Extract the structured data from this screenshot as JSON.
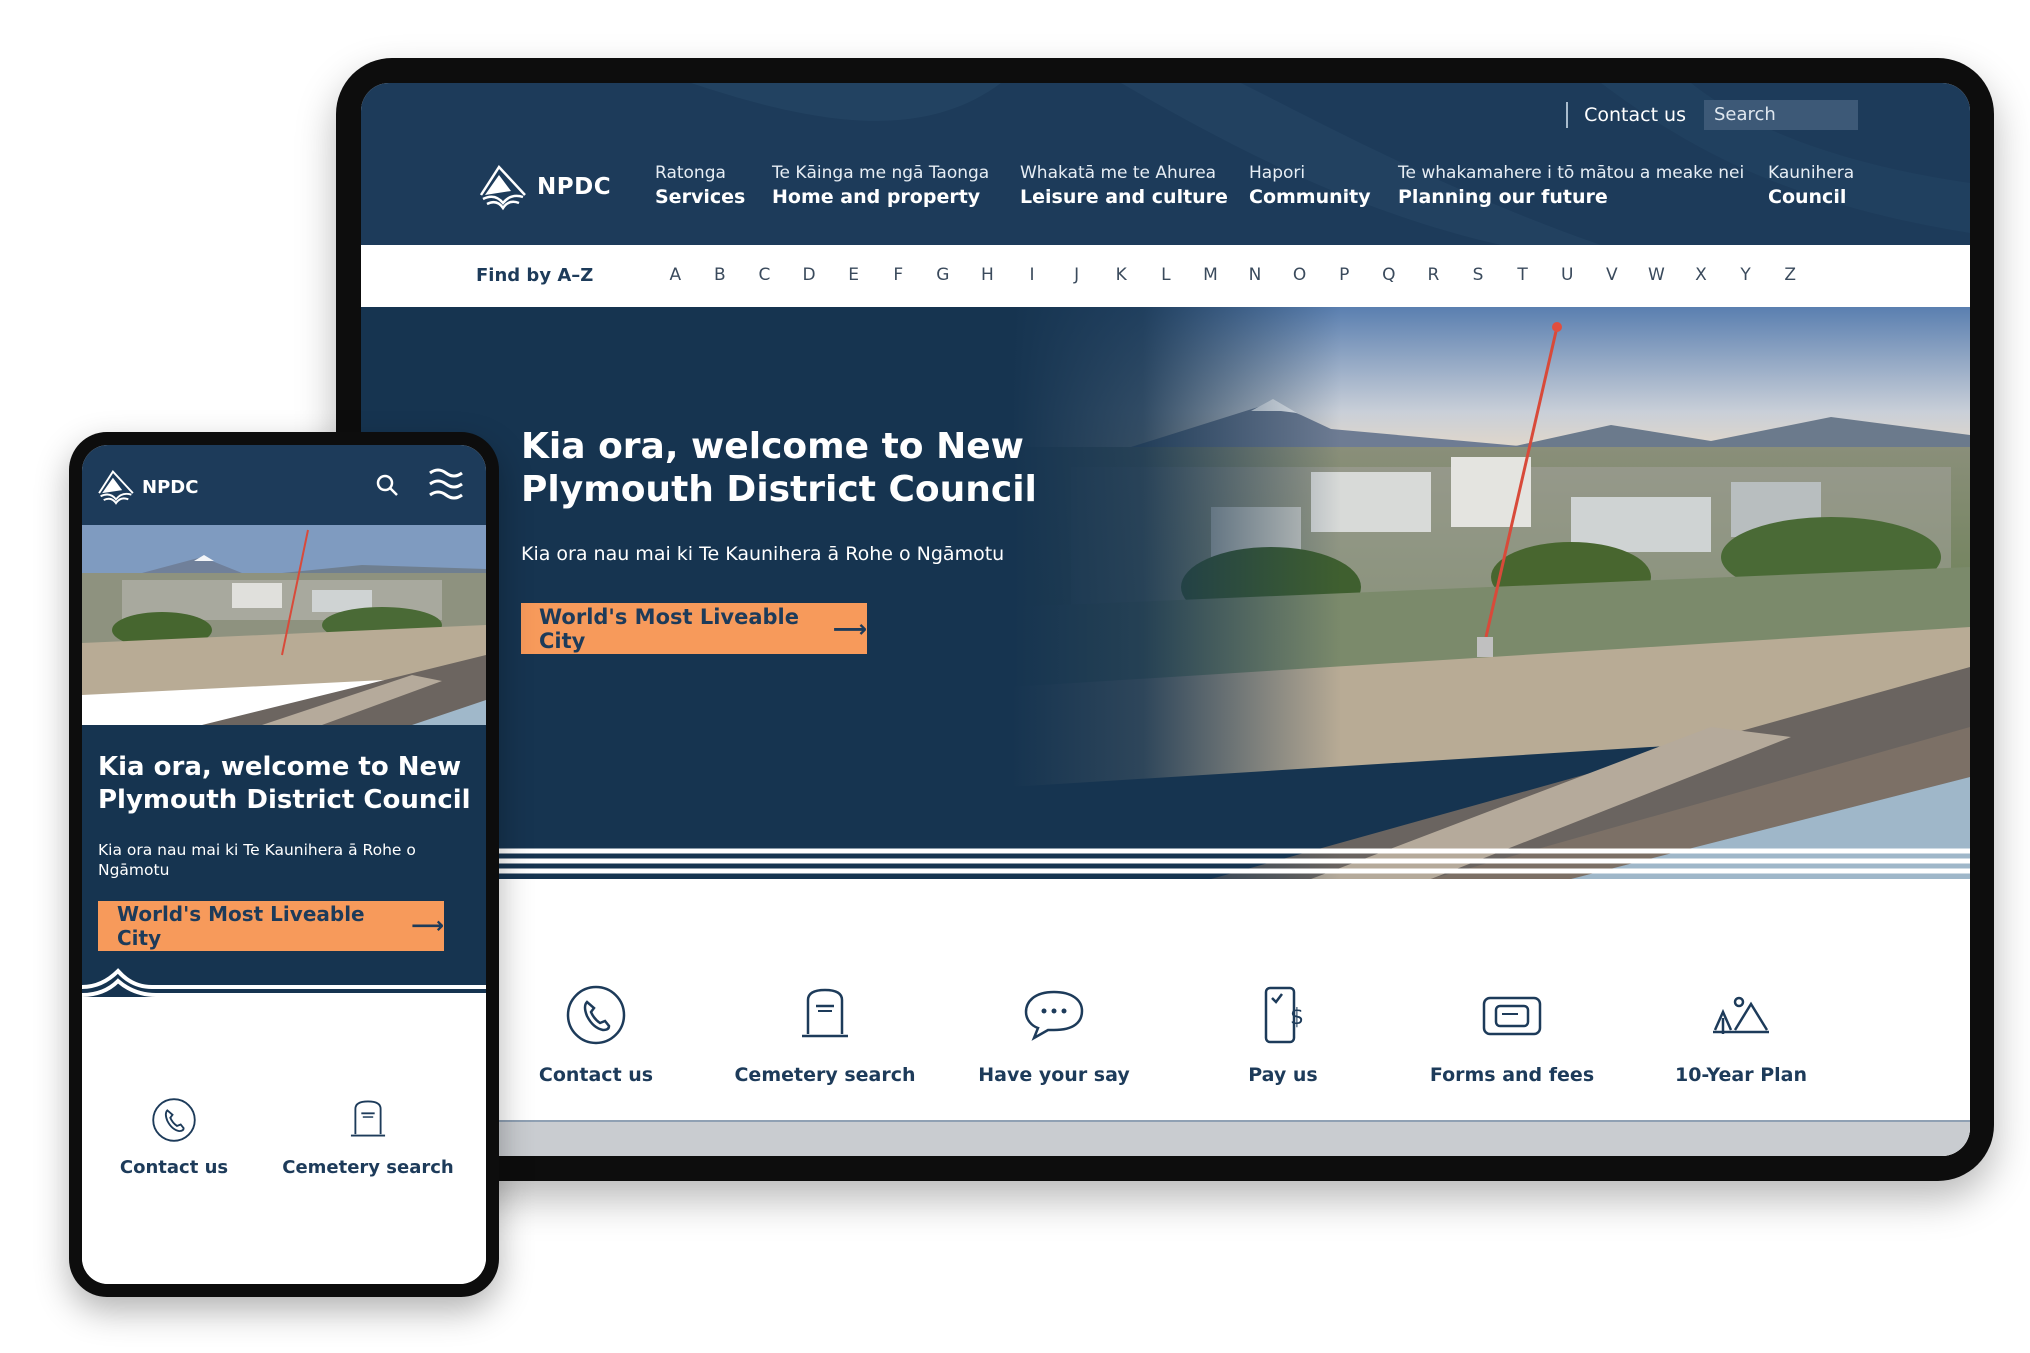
{
  "colors": {
    "navy": "#1d3b5a",
    "hero_bg": "#163450",
    "cta_orange": "#f79a5b",
    "white": "#ffffff"
  },
  "desktop": {
    "brand": "NPDC",
    "utility": {
      "contact_label": "Contact us",
      "search_placeholder": "Search"
    },
    "nav": [
      {
        "maori": "Ratonga",
        "english": "Services"
      },
      {
        "maori": "Te Kāinga me ngā Taonga",
        "english": "Home and property"
      },
      {
        "maori": "Whakatā me te Ahurea",
        "english": "Leisure and culture"
      },
      {
        "maori": "Hapori",
        "english": "Community"
      },
      {
        "maori": "Te whakamahere i tō mātou a meake nei",
        "english": "Planning our future"
      },
      {
        "maori": "Kaunihera",
        "english": "Council"
      }
    ],
    "az": {
      "label": "Find by A–Z",
      "letters": [
        "A",
        "B",
        "C",
        "D",
        "E",
        "F",
        "G",
        "H",
        "I",
        "J",
        "K",
        "L",
        "M",
        "N",
        "O",
        "P",
        "Q",
        "R",
        "S",
        "T",
        "U",
        "V",
        "W",
        "X",
        "Y",
        "Z"
      ]
    },
    "hero": {
      "title": "Kia ora, welcome to New Plymouth District Council",
      "subtitle": "Kia ora nau mai ki Te Kaunihera ā Rohe o Ngāmotu",
      "cta_label": "World's Most Liveable City",
      "cta_icon": "arrow-right-icon"
    },
    "quick_links": [
      {
        "label": "Contact us",
        "icon": "phone-icon"
      },
      {
        "label": "Cemetery search",
        "icon": "headstone-icon"
      },
      {
        "label": "Have your say",
        "icon": "speech-bubble-icon"
      },
      {
        "label": "Pay us",
        "icon": "mobile-payment-icon"
      },
      {
        "label": "Forms and fees",
        "icon": "forms-icon"
      },
      {
        "label": "10-Year Plan",
        "icon": "landscape-plan-icon"
      }
    ]
  },
  "mobile": {
    "brand": "NPDC",
    "header_icons": [
      "search-icon",
      "menu-icon"
    ],
    "hero": {
      "title": "Kia ora, welcome to New Plymouth District Council",
      "subtitle": "Kia ora nau mai ki Te Kaunihera ā Rohe o Ngāmotu",
      "cta_label": "World's Most Liveable City"
    },
    "quick_links": [
      {
        "label": "Contact us",
        "icon": "phone-icon"
      },
      {
        "label": "Cemetery search",
        "icon": "headstone-icon"
      }
    ]
  }
}
